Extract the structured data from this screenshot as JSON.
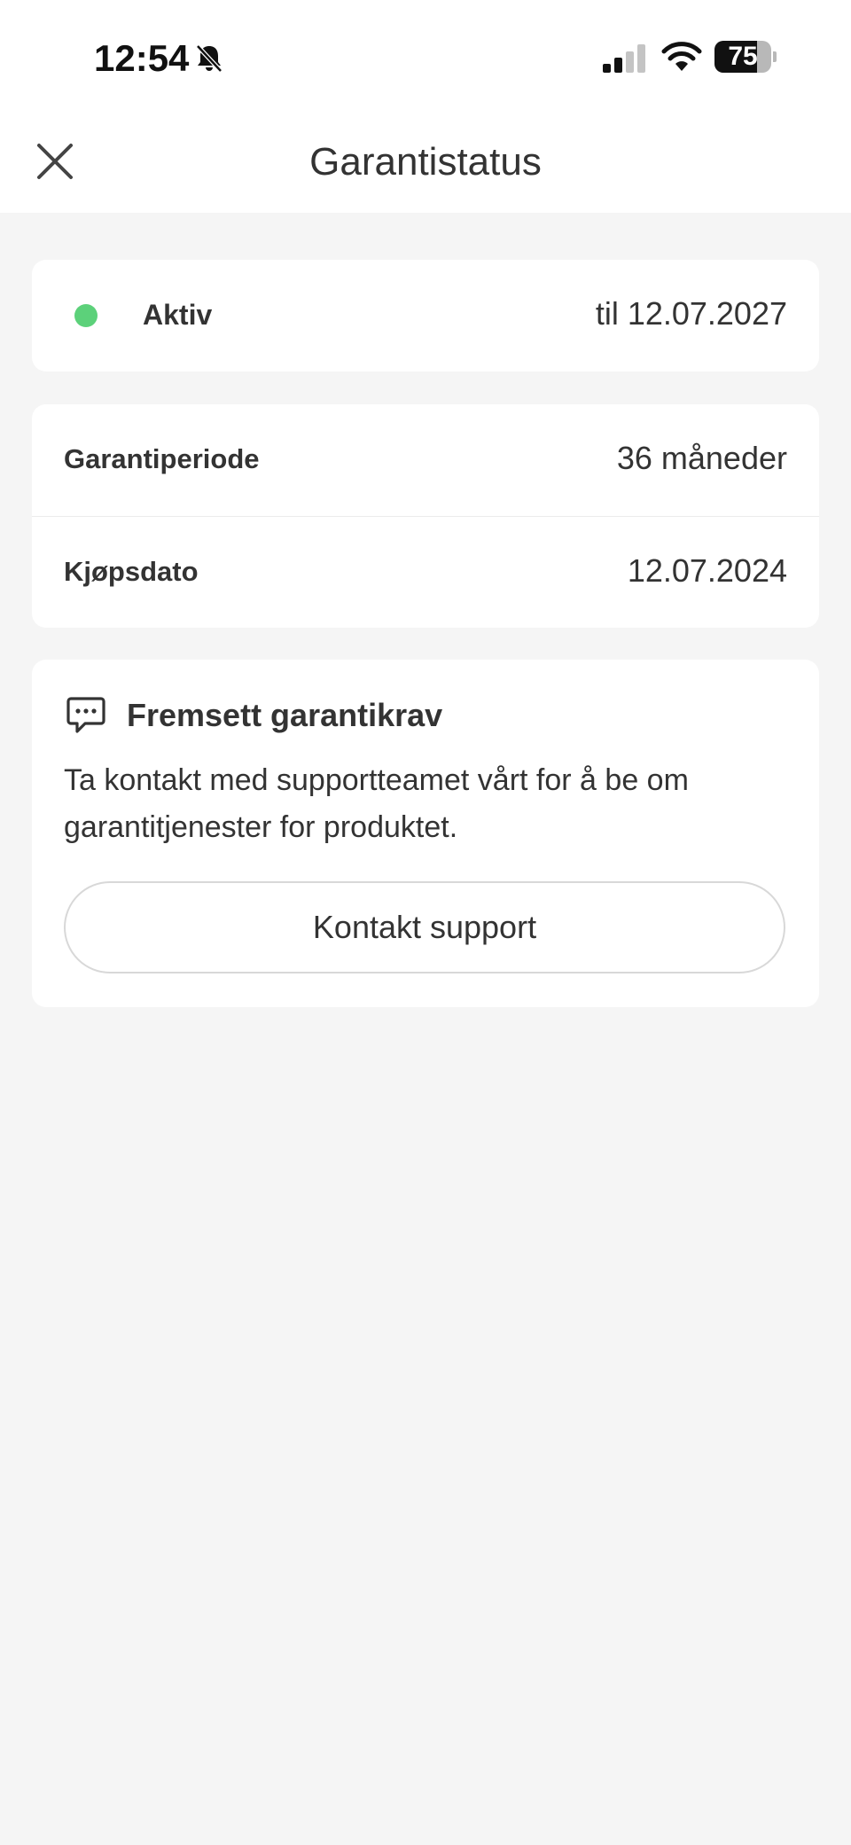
{
  "status_bar": {
    "time": "12:54",
    "battery_level": "75",
    "battery_fraction": 0.75,
    "icons": [
      "bell-slash-icon",
      "cellular-signal-icon",
      "wifi-icon",
      "battery-icon"
    ]
  },
  "header": {
    "title": "Garantistatus",
    "close_icon": "close-icon"
  },
  "warranty_status": {
    "label": "Aktiv",
    "until": "til 12.07.2027",
    "dot_color": "#5cd17a"
  },
  "details": [
    {
      "label": "Garantiperiode",
      "value": "36 måneder"
    },
    {
      "label": "Kjøpsdato",
      "value": "12.07.2024"
    }
  ],
  "claim": {
    "icon": "chat-bubble-icon",
    "title": "Fremsett garantikrav",
    "description": "Ta kontakt med supportteamet vårt for å be om garantitjenester for produktet.",
    "button_label": "Kontakt support"
  },
  "colors": {
    "background": "#f5f5f5",
    "card": "#ffffff",
    "text": "#333333",
    "status_active": "#5cd17a"
  }
}
